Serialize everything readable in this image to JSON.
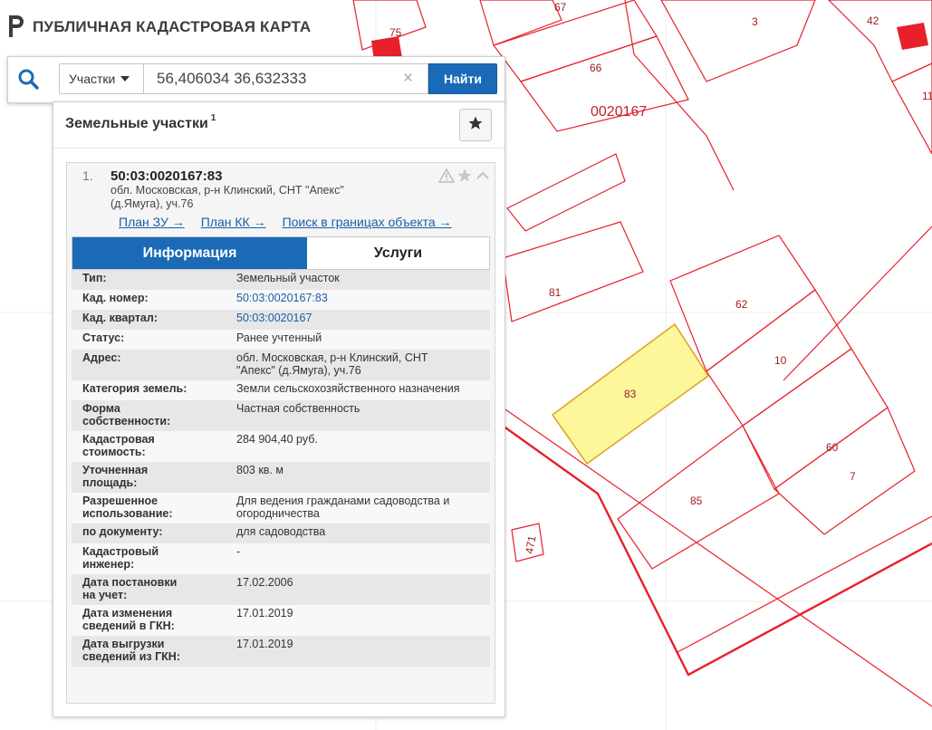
{
  "brand": {
    "title": "ПУБЛИЧНАЯ КАДАСТРОВАЯ КАРТА"
  },
  "search": {
    "type_label": "Участки",
    "query": "56,406034 36,632333",
    "clear_glyph": "×",
    "find_label": "Найти"
  },
  "panel": {
    "title": "Земельные участки",
    "count": "1"
  },
  "result": {
    "number": "1.",
    "cadastral_id": "50:03:0020167:83",
    "address_line1": "обл. Московская, р-н Клинский, СНТ \"Апекс\"",
    "address_line2": "(д.Ямуга), уч.76",
    "links": [
      "План ЗУ →",
      "План КК →",
      "Поиск в границах объекта →"
    ],
    "tabs": [
      "Информация",
      "Услуги"
    ]
  },
  "info": {
    "type": {
      "label": "Тип:",
      "value": "Земельный участок"
    },
    "cad_number": {
      "label": "Кад. номер:",
      "value": "50:03:0020167:83"
    },
    "cad_quarter": {
      "label": "Кад. квартал:",
      "value": "50:03:0020167"
    },
    "status": {
      "label": "Статус:",
      "value": "Ранее учтенный"
    },
    "address": {
      "label": "Адрес:",
      "value1": "обл. Московская, р-н Клинский, СНТ",
      "value2": "\"Апекс\" (д.Ямуга), уч.76"
    },
    "category": {
      "label": "Категория земель:",
      "value": "Земли сельскохозяйственного назначения"
    },
    "ownership": {
      "label1": "Форма",
      "label2": "собственности:",
      "value": "Частная собственность"
    },
    "cost": {
      "label1": "Кадастровая",
      "label2": "стоимость:",
      "value": "284 904,40 руб."
    },
    "area": {
      "label1": "Уточненная",
      "label2": "площадь:",
      "value": "803 кв. м"
    },
    "permitted_use": {
      "label1": "Разрешенное",
      "label2": "использование:",
      "value1": "Для ведения гражданами садоводства и",
      "value2": "огородничества"
    },
    "by_document": {
      "label": "по документу:",
      "value": "для садоводства"
    },
    "engineer": {
      "label1": "Кадастровый",
      "label2": "инженер:",
      "value": "-"
    },
    "registered_date": {
      "label1": "Дата постановки",
      "label2": "на учет:",
      "value": "17.02.2006"
    },
    "changed_date": {
      "label1": "Дата изменения",
      "label2": "сведений в ГКН:",
      "value": "17.01.2019"
    },
    "export_date": {
      "label1": "Дата выгрузки",
      "label2": "сведений из ГКН:",
      "value": "17.01.2019"
    }
  },
  "map": {
    "quarter_label": "0020167",
    "parcels": {
      "p67": "67",
      "p3": "3",
      "p42": "42",
      "p75": "75",
      "p66": "66",
      "p11": "11",
      "p81": "81",
      "p62": "62",
      "p10": "10",
      "p83": "83",
      "p60": "60",
      "p7": "7",
      "p85": "85",
      "p471": "471"
    }
  },
  "colors": {
    "accent": "#1a6ab7",
    "parcel_border": "#e8202a",
    "selected_fill": "#fbf79a",
    "selected_border": "#e0a020"
  }
}
